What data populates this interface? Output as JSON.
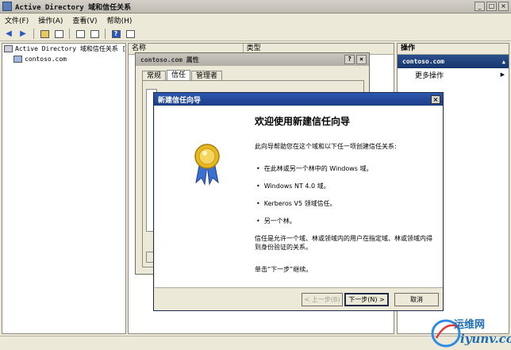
{
  "window": {
    "title": "Active Directory 域和信任关系",
    "controls": [
      "_",
      "□",
      "×"
    ]
  },
  "menu": [
    "文件(F)",
    "操作(A)",
    "查看(V)",
    "帮助(H)"
  ],
  "tree": {
    "root": "Active Directory 域和信任关系 [",
    "child": "contoso.com"
  },
  "list": {
    "columns": [
      "名称",
      "类型"
    ]
  },
  "actions": {
    "header": "操作",
    "band": "contoso.com",
    "items": [
      "更多操作"
    ]
  },
  "properties_dialog": {
    "title": "contoso.com 属性",
    "controls": [
      "?",
      "×"
    ],
    "tabs": [
      "常规",
      "信任",
      "管理者"
    ],
    "active_tab": 1
  },
  "wizard": {
    "title": "新建信任向导",
    "heading": "欢迎使用新建信任向导",
    "intro": "此向导帮助您在这个域和以下任一项创建信任关系:",
    "bullets": [
      "在此林或另一个林中的 Windows 域。",
      "Windows NT 4.0 域。",
      "Kerberos V5 领域信任。",
      "另一个林。"
    ],
    "note": "信任是允许一个域、林或领域内的用户在指定域、林或领域内得到身份验证的关系。",
    "hint": "单击“下一步”继续。",
    "buttons": {
      "back": "< 上一步(B)",
      "next": "下一步(N) >",
      "cancel": "取消"
    },
    "close": "×"
  },
  "watermark": {
    "line1": "运维网",
    "line2": "iyunv.com"
  },
  "colors": {
    "wizard_titlebar": "#2d58b0",
    "action_band": "#2b4f8c",
    "medal_gold": "#e8b820",
    "ribbon_blue": "#3b6fd0"
  }
}
